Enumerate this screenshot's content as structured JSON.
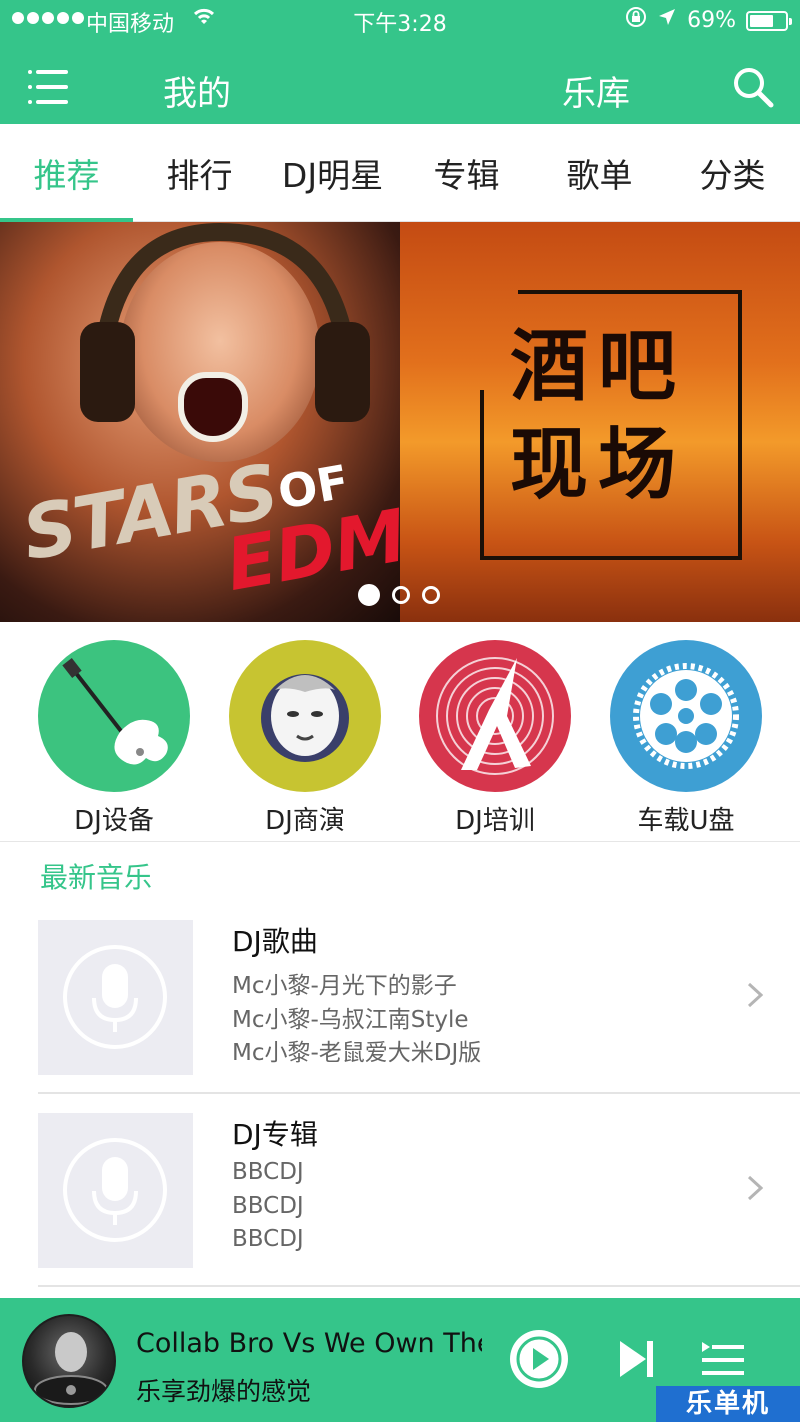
{
  "status_bar": {
    "carrier": "中国移动",
    "time": "下午3:28",
    "battery_percent": "69%",
    "battery_level": 0.69,
    "icons": [
      "signal-dots-icon",
      "wifi-icon",
      "rotation-lock-icon",
      "location-arrow-icon",
      "battery-icon"
    ]
  },
  "header": {
    "mine_label": "我的",
    "library_label": "乐库",
    "icons": [
      "menu-icon",
      "search-icon"
    ]
  },
  "tabs": [
    {
      "label": "推荐",
      "active": true
    },
    {
      "label": "排行",
      "active": false
    },
    {
      "label": "DJ明星",
      "active": false
    },
    {
      "label": "专辑",
      "active": false
    },
    {
      "label": "歌单",
      "active": false
    },
    {
      "label": "分类",
      "active": false
    }
  ],
  "banner": {
    "left_text_1": "STARS",
    "left_text_2": "OF",
    "left_text_3": "EDM",
    "right_text_line1": "酒吧",
    "right_text_line2": "现场",
    "slide_count": 3,
    "active_slide": 1
  },
  "categories": [
    {
      "label": "DJ设备",
      "color": "#3cc37f",
      "icon": "guitar-icon"
    },
    {
      "label": "DJ商演",
      "color": "#c7c431",
      "icon": "performer-icon"
    },
    {
      "label": "DJ培训",
      "color": "#d6364d",
      "icon": "dancer-icon"
    },
    {
      "label": "车载U盘",
      "color": "#3e9fd3",
      "icon": "film-reel-icon"
    }
  ],
  "latest": {
    "title": "最新音乐",
    "items": [
      {
        "title": "DJ歌曲",
        "lines": [
          "Mc小黎-月光下的影子",
          "Mc小黎-乌叔江南Style",
          "Mc小黎-老鼠爱大米DJ版"
        ]
      },
      {
        "title": "DJ专辑",
        "lines": [
          "BBCDJ",
          "BBCDJ",
          "BBCDJ"
        ]
      }
    ]
  },
  "player": {
    "song": "Collab Bro Vs We Own The",
    "tagline": "乐享劲爆的感觉",
    "icons": [
      "play-icon",
      "next-track-icon",
      "playlist-icon"
    ]
  },
  "watermark": "乐单机",
  "colors": {
    "brand_green": "#35c58a",
    "tab_text": "#222222",
    "watermark_blue": "#1f6fd0"
  }
}
